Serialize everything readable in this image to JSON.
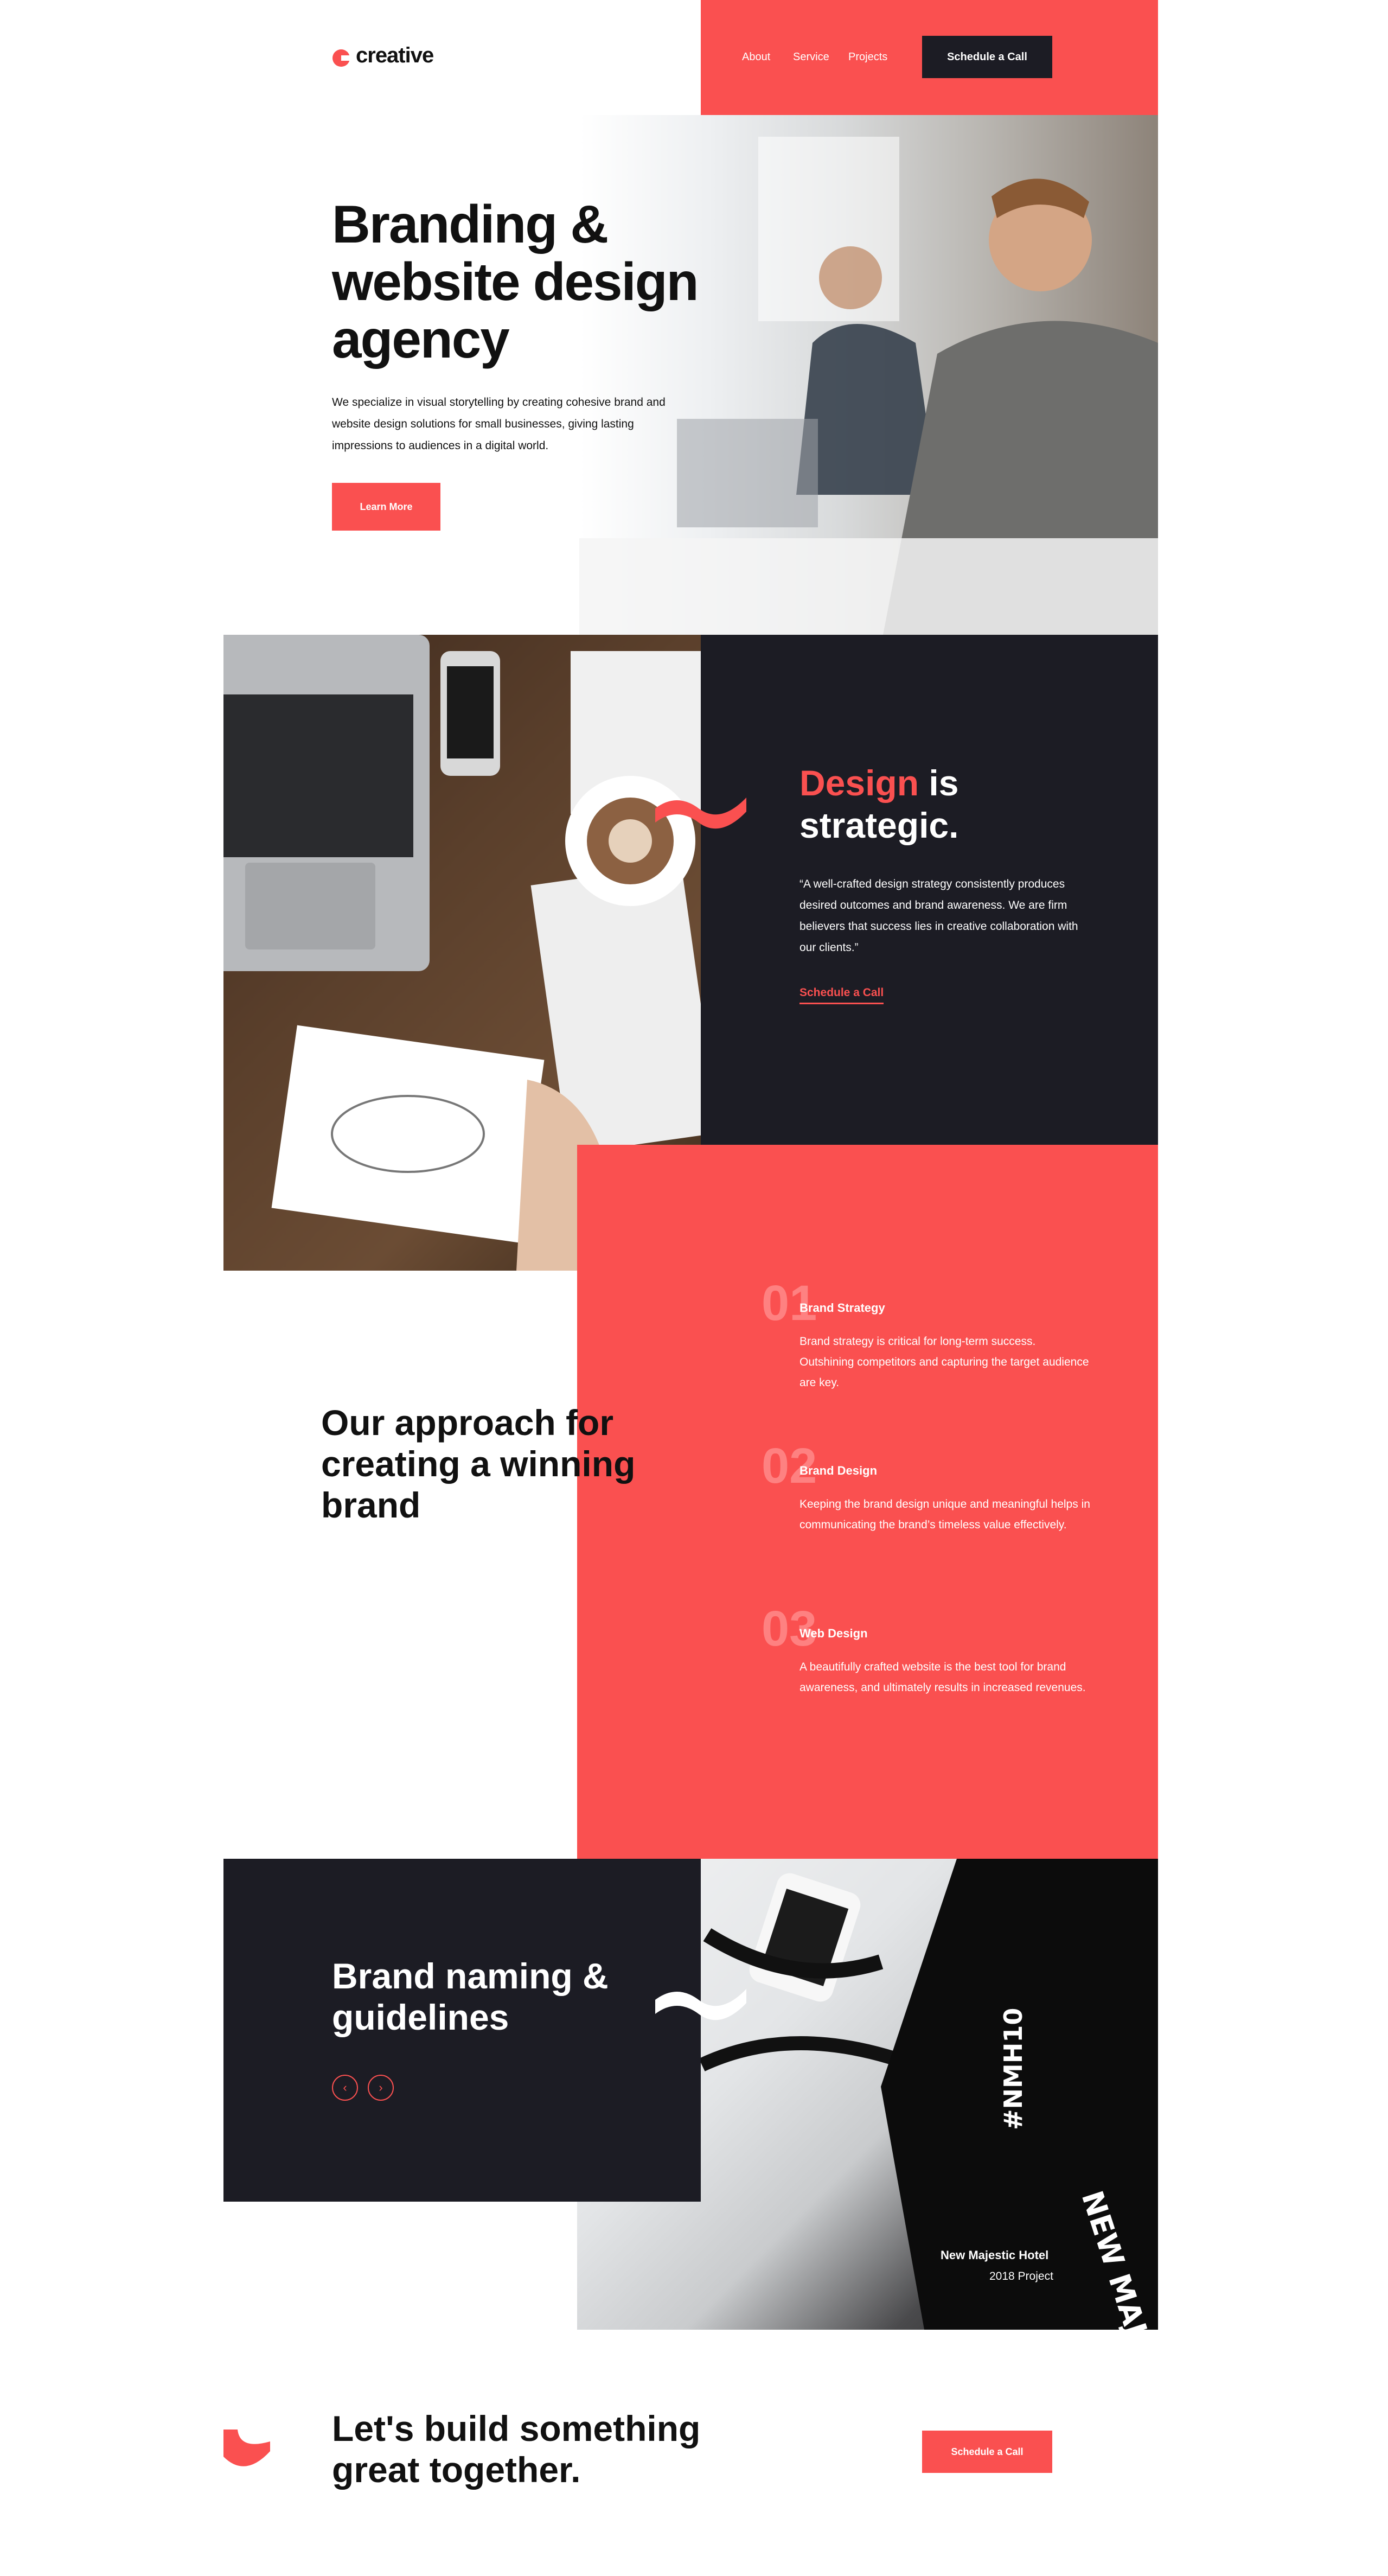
{
  "brand": {
    "name": "creative",
    "accent": "#fa5050",
    "dark": "#1c1c24"
  },
  "nav": {
    "items": [
      "About",
      "Service",
      "Projects"
    ],
    "cta": "Schedule a Call"
  },
  "hero": {
    "title": "Branding & website design agency",
    "body": "We specialize in visual storytelling by creating cohesive brand and website design solutions for small businesses, giving lasting impressions to audiences in a digital world.",
    "button": "Learn More",
    "image_icon": "office-photo"
  },
  "strategic": {
    "title_accent": "Design",
    "title_rest_1": " is",
    "title_rest_2": "strategic.",
    "body": "“A well-crafted design strategy consistently produces desired outcomes and brand awareness. We are firm believers that success lies in creative collaboration with our clients.”",
    "link": "Schedule a Call",
    "image_icon": "desk-photo"
  },
  "approach": {
    "title": "Our approach for creating a winning brand",
    "steps": [
      {
        "num": "01",
        "title": "Brand Strategy",
        "body": "Brand strategy is critical for long-term success. Outshining competitors and capturing the target audience are key."
      },
      {
        "num": "02",
        "title": "Brand Design",
        "body": "Keeping the brand design unique and meaningful helps in communicating the brand’s timeless value effectively."
      },
      {
        "num": "03",
        "title": "Web Design",
        "body": "A beautifully crafted website is the best tool for brand awareness, and ultimately results in increased revenues."
      }
    ]
  },
  "naming": {
    "title": "Brand naming & guidelines",
    "prev_icon": "chevron-left-icon",
    "next_icon": "chevron-right-icon",
    "prev_glyph": "‹",
    "next_glyph": "›",
    "project_name": "New Majestic Hotel",
    "project_year": "2018 Project",
    "bag_text_1": "#NMH10",
    "bag_text_2": "NEW MAJESTIC HOTEL"
  },
  "footer": {
    "title": "Let's build something great together.",
    "cta": "Schedule a Call"
  }
}
